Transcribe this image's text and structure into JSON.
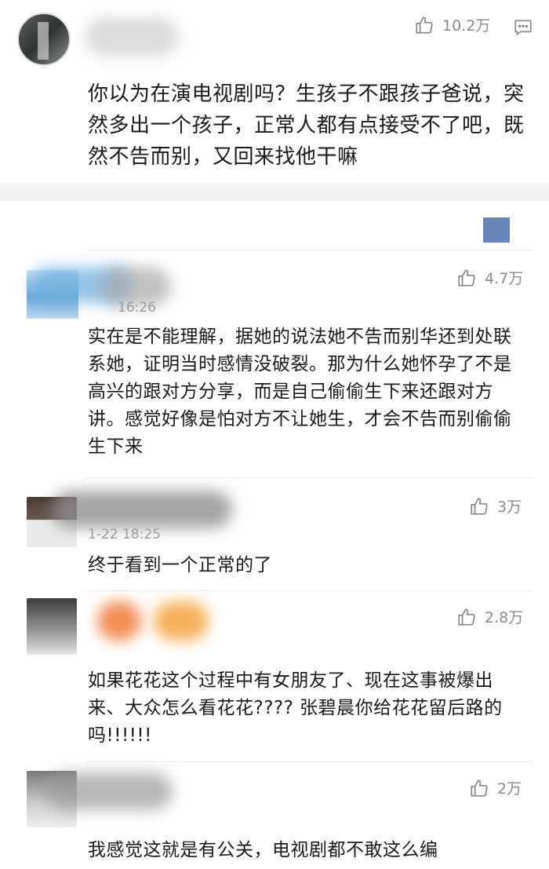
{
  "comments": [
    {
      "likes": "10.2万",
      "text": "你以为在演电视剧吗？生孩子不跟孩子爸说，突然多出一个孩子，正常人都有点接受不了吧，既然不告而别，又回来找他干嘛"
    },
    {
      "likes": "4.7万",
      "time": "16:26",
      "text": "实在是不能理解，据她的说法她不告而别华还到处联系她，证明当时感情没破裂。那为什么她怀孕了不是高兴的跟对方分享，而是自己偷偷生下来还跟对方讲。感觉好像是怕对方不让她生，才会不告而别偷偷生下来"
    },
    {
      "likes": "3万",
      "time": "1-22 18:25",
      "text": "终于看到一个正常的了"
    },
    {
      "likes": "2.8万",
      "text": "如果花花这个过程中有女朋友了、现在这事被爆出来、大众怎么看花花???? 张碧晨你给花花留后路的吗!!!!!!"
    },
    {
      "likes": "2万",
      "text": "我感觉这就是有公关，电视剧都不敢这么编"
    }
  ],
  "colors": {
    "like_gray": "#8a8a8a",
    "more_block": "#6a86b8",
    "band": "#f2f2f2"
  }
}
